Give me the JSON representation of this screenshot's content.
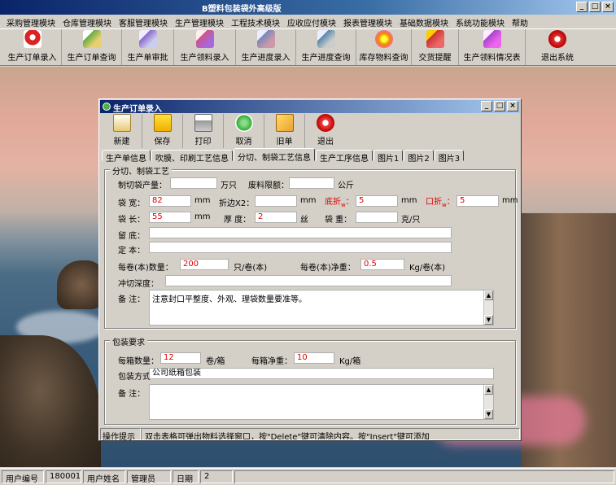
{
  "app": {
    "title": "B塑料包装袋外高级版"
  },
  "menu": [
    "采购管理模块",
    "仓库管理模块",
    "客服管理模块",
    "生产管理模块",
    "工程技术模块",
    "应收应付模块",
    "报表管理模块",
    "基础数据模块",
    "系统功能模块",
    "帮助"
  ],
  "toolbar": [
    {
      "label": "生产订单录入",
      "icon": "pdf-icon",
      "color": "#d22"
    },
    {
      "label": "生产订单查询",
      "icon": "document-search-icon",
      "color": "#6a4"
    },
    {
      "label": "生产单审批",
      "icon": "approve-icon",
      "color": "#86c"
    },
    {
      "label": "生产领料录入",
      "icon": "material-icon",
      "color": "#c58"
    },
    {
      "label": "生产进度录入",
      "icon": "progress-icon",
      "color": "#78b"
    },
    {
      "label": "生产进度查询",
      "icon": "progress-search-icon",
      "color": "#58a"
    },
    {
      "label": "库存物料查询",
      "icon": "flower-icon",
      "color": "#e80"
    },
    {
      "label": "交货提醒",
      "icon": "delivery-icon",
      "color": "#c33"
    },
    {
      "label": "生产领料情况表",
      "icon": "report-icon",
      "color": "#a4c"
    },
    {
      "label": "退出系统",
      "icon": "power-icon",
      "color": "#d33"
    }
  ],
  "child": {
    "title": "生产订单录入",
    "toolbar": [
      {
        "label": "新建",
        "icon": "new-document-icon",
        "color": "#e8c870"
      },
      {
        "label": "保存",
        "icon": "save-icon",
        "color": "#f0c000"
      },
      {
        "label": "打印",
        "icon": "printer-icon",
        "color": "#999"
      },
      {
        "label": "取消",
        "icon": "undo-icon",
        "color": "#3a3"
      },
      {
        "label": "旧单",
        "icon": "old-order-icon",
        "color": "#e9a030"
      },
      {
        "label": "退出",
        "icon": "exit-icon",
        "color": "#d33"
      }
    ],
    "tabs": [
      "生产单信息",
      "吹膜、印刷工艺信息",
      "分切、制袋工艺信息",
      "生产工序信息",
      "图片1",
      "图片2",
      "图片3"
    ],
    "active_tab": 2,
    "cut_group": {
      "title": "分切、制袋工艺",
      "cut_output_label": "制切袋产量：",
      "cut_output_value": "",
      "cut_output_unit": "万只",
      "scrap_limit_label": "废料限额：",
      "scrap_limit_value": "",
      "scrap_limit_unit": "公斤",
      "width_label": "袋 宽：",
      "width_value": "82",
      "width_unit": "mm",
      "fold_label": "折边X2：",
      "fold_value": "",
      "fold_unit": "mm",
      "bottom_fold_label": "底折",
      "bottom_fold_sub": "w",
      "bottom_fold_value": "5",
      "bottom_fold_unit": "mm",
      "mouth_fold_label": "口折",
      "mouth_fold_sub": "w",
      "mouth_fold_value": "5",
      "mouth_fold_unit": "mm",
      "length_label": "袋 长：",
      "length_value": "55",
      "length_unit": "mm",
      "thickness_label": "厚 度：",
      "thickness_value": "2",
      "thickness_unit": "丝",
      "bag_weight_label": "袋 重：",
      "bag_weight_value": "",
      "bag_weight_unit": "克/只",
      "retain_bottom_label": "留 底：",
      "retain_bottom_value": "",
      "fixed_label": "定 本：",
      "fixed_value": "",
      "per_roll_qty_label": "每卷(本)数量：",
      "per_roll_qty_value": "200",
      "per_roll_qty_unit": "只/卷(本)",
      "per_roll_weight_label": "每卷(本)净重：",
      "per_roll_weight_value": "0.5",
      "per_roll_weight_unit": "Kg/卷(本)",
      "punch_depth_label": "冲切深度：",
      "punch_depth_value": "",
      "remarks_label": "备 注：",
      "remarks_value": "注意封口平整度、外观、理袋数量要准等。"
    },
    "pack_group": {
      "title": "包装要求",
      "per_box_qty_label": "每箱数量：",
      "per_box_qty_value": "12",
      "per_box_qty_unit": "卷/箱",
      "per_box_weight_label": "每箱净重：",
      "per_box_weight_value": "10",
      "per_box_weight_unit": "Kg/箱",
      "method_label": "包装方式：",
      "method_value": "公司纸箱包装",
      "remarks_label": "备 注：",
      "remarks_value": ""
    },
    "hint_label": "操作提示",
    "hint_text": "双击表格可弹出物料选择窗口，按\"Delete\"键可清除内容。按\"Insert\"键可添加"
  },
  "status": {
    "user_id_label": "用户编号",
    "user_id": "180001",
    "user_name_label": "用户姓名",
    "user_name": "管理员",
    "date_label": "日期",
    "date": "2"
  }
}
